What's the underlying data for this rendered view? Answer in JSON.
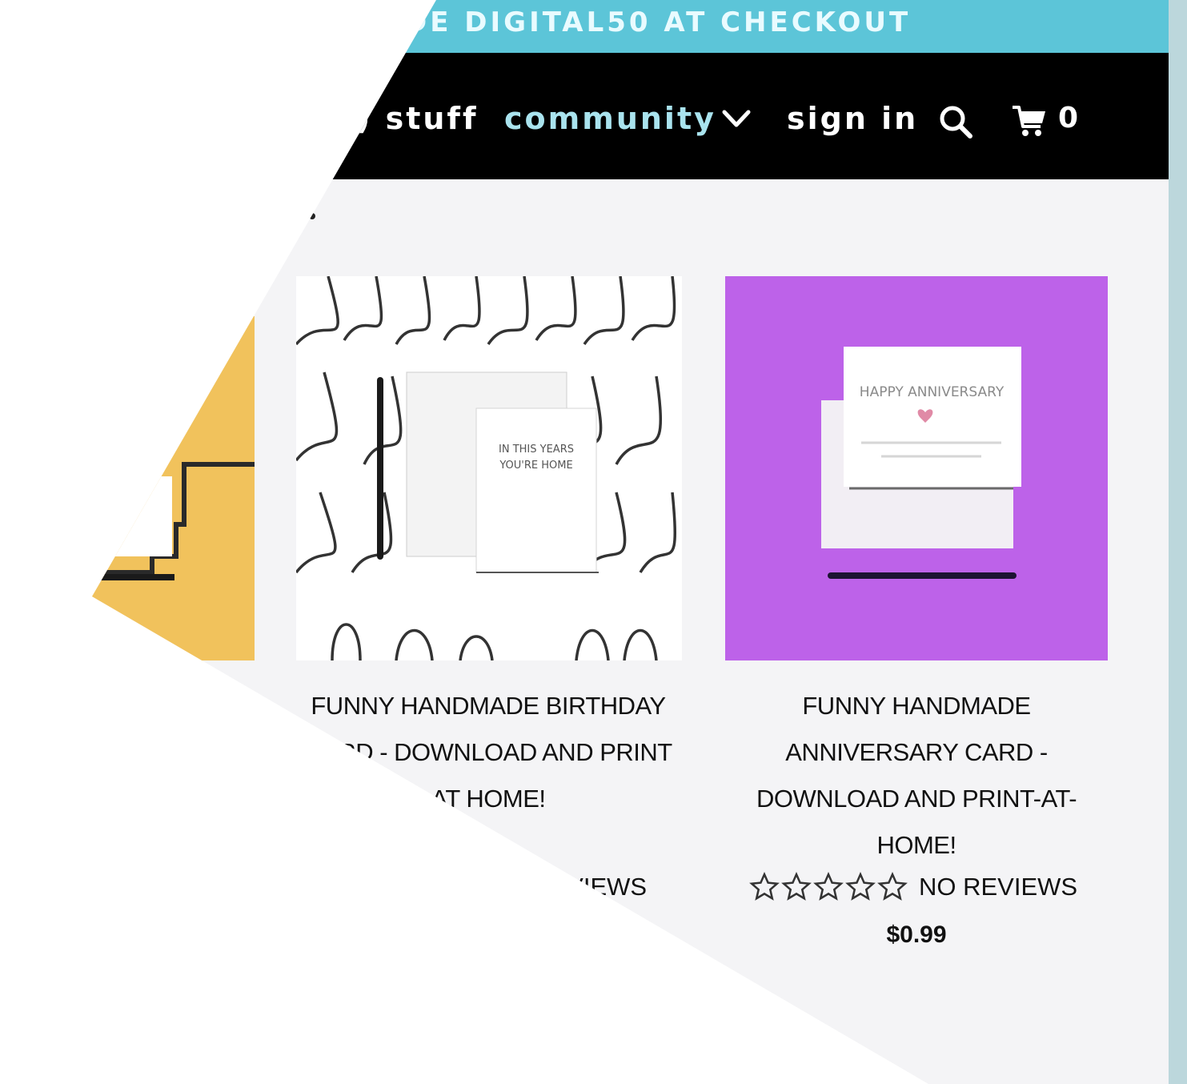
{
  "promo": {
    "text": "DE DIGITAL50 AT CHECKOUT"
  },
  "nav": {
    "items": [
      {
        "label": ") stuff"
      },
      {
        "label": "community"
      },
      {
        "label": "sign in"
      }
    ],
    "cart_count": "0",
    "icons": [
      "chevron-down-icon",
      "search-icon",
      "cart-icon"
    ],
    "colors": {
      "bar": "#000000",
      "community_link": "#a9e3ee",
      "promo_bar": "#5cc5d8"
    }
  },
  "products": [
    {
      "title": "FUNNY HANDMADE BIRTHDAY CARD - DOWNLOAD AND PRINT AT HOME!",
      "rating_label": "NO REVIEWS",
      "stars_filled": 0,
      "card_text": "IN THIS YEARS YOU'RE HOME",
      "image_background": "#ffffff"
    },
    {
      "title": "FUNNY HANDMADE ANNIVERSARY CARD - DOWNLOAD AND PRINT-AT-HOME!",
      "rating_label": "NO REVIEWS",
      "stars_filled": 0,
      "price": "$0.99",
      "card_text": "HAPPY ANNIVERSARY",
      "image_background": "#bd62e9"
    }
  ],
  "partial_card": {
    "background": "#f1c25c"
  }
}
